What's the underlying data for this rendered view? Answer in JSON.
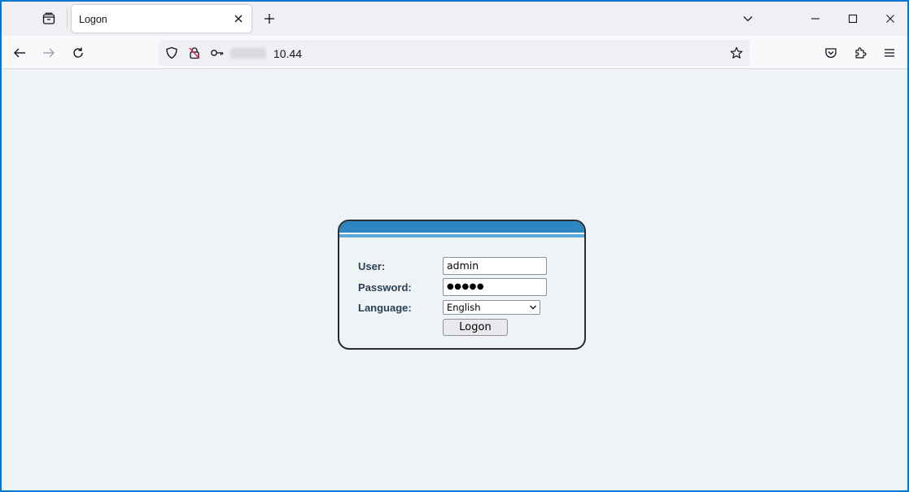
{
  "browser": {
    "tab_title": "Logon",
    "url_text": "10.44"
  },
  "login": {
    "user_label": "User:",
    "user_value": "admin",
    "password_label": "Password:",
    "password_mask": "●●●●●",
    "language_label": "Language:",
    "language_selected": "English",
    "logon_button": "Logon"
  },
  "colors": {
    "header_blue": "#2e86c1",
    "label_text": "#2b3f55",
    "page_bg": "#eef3f5"
  }
}
